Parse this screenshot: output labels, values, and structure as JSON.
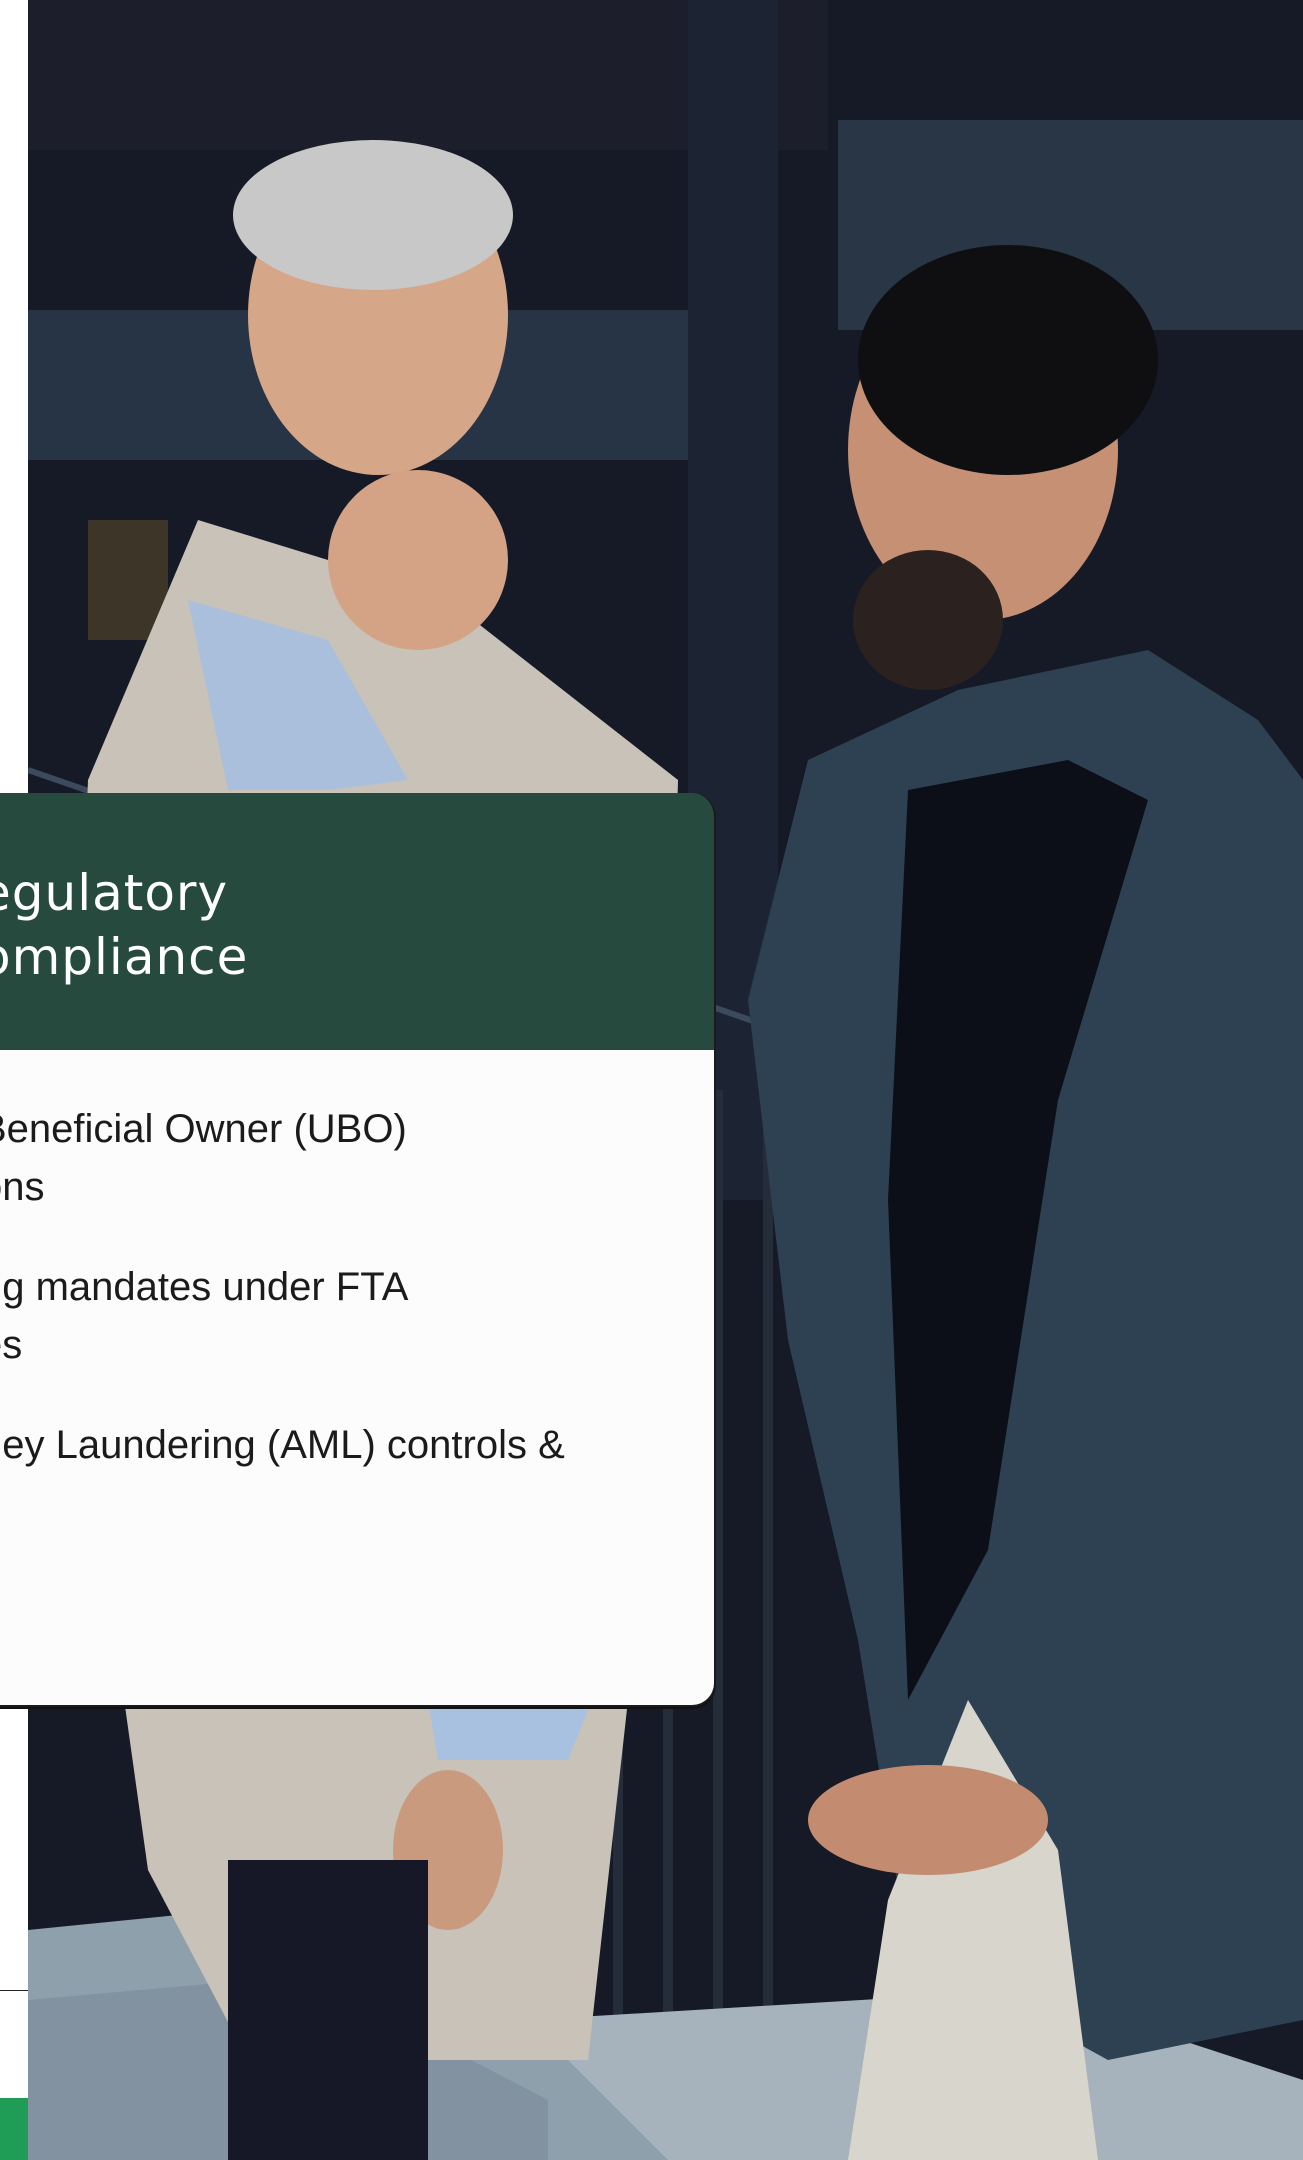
{
  "card": {
    "title": "egulatory\nompliance",
    "items": [
      "Beneficial Owner (UBO)\nons",
      "ng mandates under FTA\nes",
      "ney Laundering (AML) controls &"
    ]
  },
  "colors": {
    "header_green": "#264a3e",
    "accent_green": "#1f9d57",
    "card_body": "#fcfcfc",
    "photo_dark": "#161b27"
  }
}
